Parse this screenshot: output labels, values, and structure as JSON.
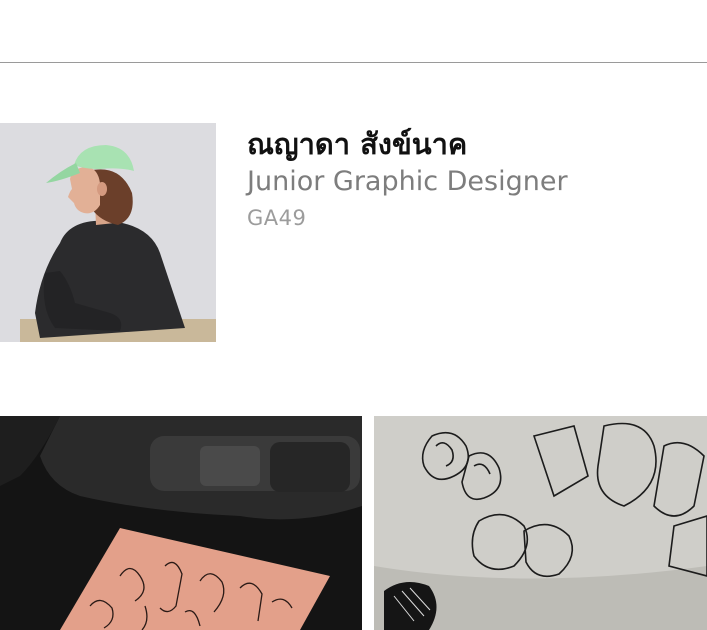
{
  "profile": {
    "name": "ณญาดา สังข์นาค",
    "role": "Junior Graphic Designer",
    "code": "GA49"
  },
  "images": {
    "portrait": "portrait-photo",
    "work": [
      "sketchbook-on-camera-photo",
      "hand-drawn-letters-photo"
    ]
  },
  "colors": {
    "name": "#111111",
    "role": "#7d7d7d",
    "code": "#9c9c9c",
    "rule": "#9a9a9a",
    "cap": "#a8e2b2"
  }
}
